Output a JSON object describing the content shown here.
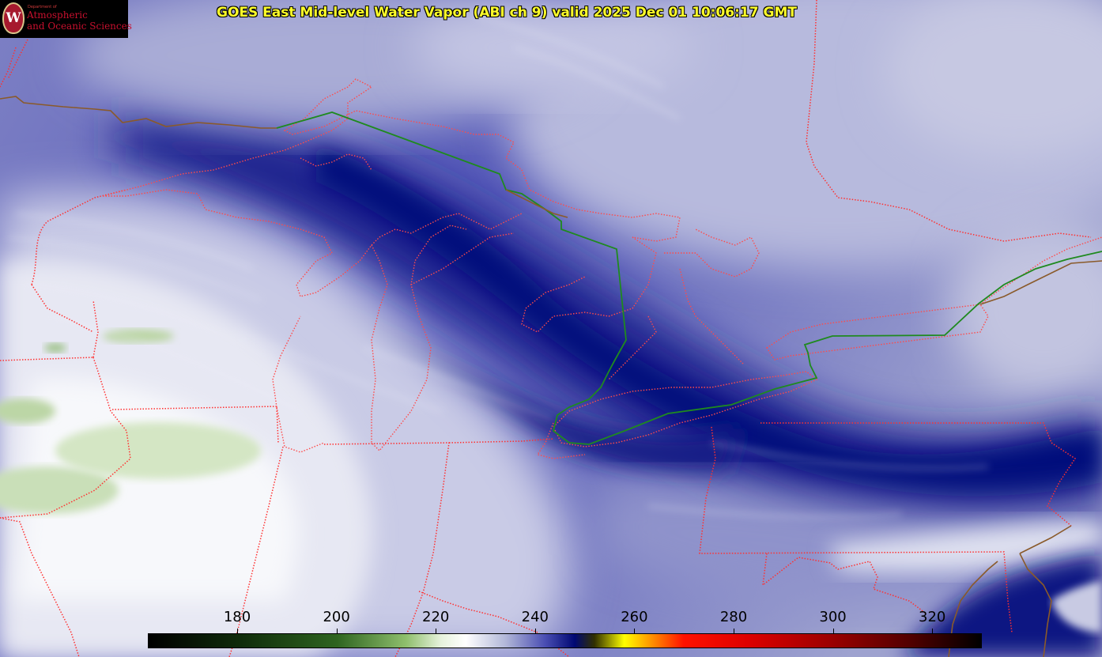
{
  "title": "GOES East Mid-level Water Vapor (ABI ch 9)  valid 2025 Dec 01 10:06:17 GMT",
  "logo": {
    "department": "Department of",
    "line1": "Atmospheric",
    "line2": "and Oceanic Sciences"
  },
  "colorbar": {
    "ticks": [
      "180",
      "200",
      "220",
      "240",
      "260",
      "280",
      "300",
      "320"
    ],
    "range": [
      162,
      330
    ],
    "stops": [
      {
        "value": 162,
        "color": "#000000"
      },
      {
        "value": 180,
        "color": "#0f2a0a"
      },
      {
        "value": 200,
        "color": "#2e6420"
      },
      {
        "value": 214,
        "color": "#8fbf6d"
      },
      {
        "value": 221,
        "color": "#e6f2dc"
      },
      {
        "value": 226,
        "color": "#ffffff"
      },
      {
        "value": 234,
        "color": "#b2b7d8"
      },
      {
        "value": 242,
        "color": "#4a4eb3"
      },
      {
        "value": 248,
        "color": "#000873"
      },
      {
        "value": 252,
        "color": "#313000"
      },
      {
        "value": 258,
        "color": "#ffff00"
      },
      {
        "value": 264,
        "color": "#ff8800"
      },
      {
        "value": 270,
        "color": "#ff1100"
      },
      {
        "value": 283,
        "color": "#dd0000"
      },
      {
        "value": 300,
        "color": "#9a0000"
      },
      {
        "value": 316,
        "color": "#500000"
      },
      {
        "value": 330,
        "color": "#000000"
      }
    ]
  },
  "colors": {
    "state_border": "#ff3030",
    "coastline_line": "#ff4a4a",
    "international_border": "#1f8a1f",
    "coast_brown": "#8a5a2a",
    "title_text": "#ffff2a"
  }
}
